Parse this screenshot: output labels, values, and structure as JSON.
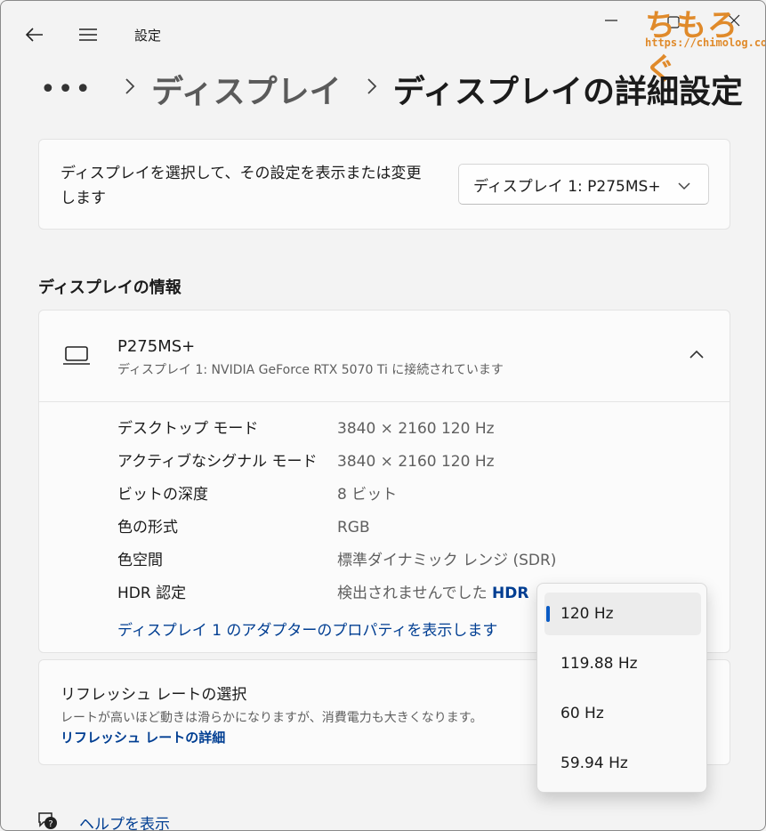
{
  "window": {
    "app_title": "設定",
    "watermark_logo": "ちもろぐ",
    "watermark_url": "https://chimolog.co/"
  },
  "breadcrumb": {
    "more": "•••",
    "items": [
      "ディスプレイ",
      "ディスプレイの詳細設定"
    ]
  },
  "select_display": {
    "description": "ディスプレイを選択して、その設定を表示または変更します",
    "selected": "ディスプレイ 1: P275MS+"
  },
  "display_info": {
    "section_title": "ディスプレイの情報",
    "name": "P275MS+",
    "subtitle": "ディスプレイ 1: NVIDIA GeForce RTX 5070 Ti に接続されています",
    "rows": [
      {
        "label": "デスクトップ モード",
        "value": "3840 × 2160 120 Hz"
      },
      {
        "label": "アクティブなシグナル モード",
        "value": "3840 × 2160 120 Hz"
      },
      {
        "label": "ビットの深度",
        "value": "8 ビット"
      },
      {
        "label": "色の形式",
        "value": "RGB"
      },
      {
        "label": "色空間",
        "value": "標準ダイナミック レンジ (SDR)"
      },
      {
        "label": "HDR 認定",
        "value": "検出されませんでした",
        "link": "HDR"
      }
    ],
    "adapter_link": "ディスプレイ 1 のアダプターのプロパティを表示します"
  },
  "refresh_rate": {
    "title": "リフレッシュ レートの選択",
    "description": "レートが高いほど動きは滑らかになりますが、消費電力も大きくなります。",
    "link": "リフレッシュ レートの詳細",
    "options": [
      "120 Hz",
      "119.88 Hz",
      "60 Hz",
      "59.94 Hz"
    ],
    "selected_index": 0
  },
  "help": {
    "label": "ヘルプを表示"
  },
  "colors": {
    "accent": "#0a5bc4",
    "link": "#003e92",
    "watermark": "#e08a2a"
  }
}
